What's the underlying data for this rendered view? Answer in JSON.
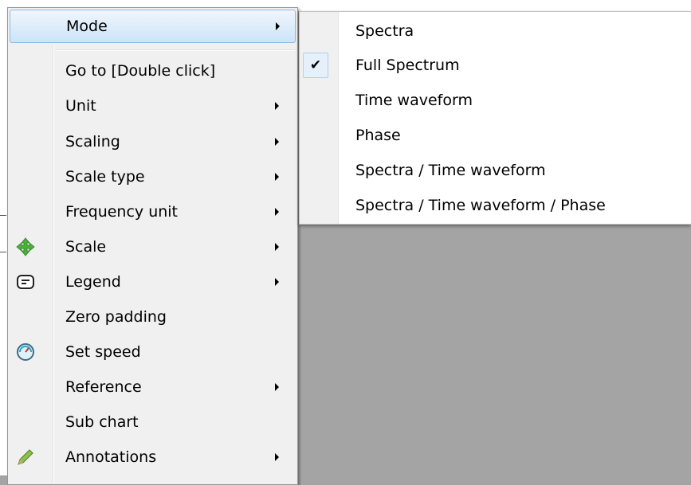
{
  "menu": {
    "items": [
      {
        "label": "Mode",
        "has_submenu": true,
        "highlighted": true,
        "icon": null
      },
      {
        "label": "Go to [Double click]",
        "has_submenu": false,
        "icon": null
      },
      {
        "label": "Unit",
        "has_submenu": true,
        "icon": null
      },
      {
        "label": "Scaling",
        "has_submenu": true,
        "icon": null
      },
      {
        "label": "Scale type",
        "has_submenu": true,
        "icon": null
      },
      {
        "label": "Frequency unit",
        "has_submenu": true,
        "icon": null
      },
      {
        "label": "Scale",
        "has_submenu": true,
        "icon": "move-arrows-icon"
      },
      {
        "label": "Legend",
        "has_submenu": true,
        "icon": "legend-icon"
      },
      {
        "label": "Zero padding",
        "has_submenu": false,
        "icon": null
      },
      {
        "label": "Set speed",
        "has_submenu": false,
        "icon": "speedometer-icon"
      },
      {
        "label": "Reference",
        "has_submenu": true,
        "icon": null
      },
      {
        "label": "Sub chart",
        "has_submenu": false,
        "icon": null
      },
      {
        "label": "Annotations",
        "has_submenu": true,
        "icon": "pencil-icon"
      }
    ]
  },
  "submenu": {
    "items": [
      {
        "label": "Spectra",
        "checked": false
      },
      {
        "label": "Full Spectrum",
        "checked": true
      },
      {
        "label": "Time waveform",
        "checked": false
      },
      {
        "label": "Phase",
        "checked": false
      },
      {
        "label": "Spectra / Time waveform",
        "checked": false
      },
      {
        "label": "Spectra / Time waveform / Phase",
        "checked": false
      }
    ],
    "check_glyph": "✔"
  },
  "colors": {
    "background": "#a4a4a4",
    "menu_bg": "#f0f0f0",
    "highlight_border": "#8fb8e0",
    "check_bg": "#e6f0fa"
  }
}
